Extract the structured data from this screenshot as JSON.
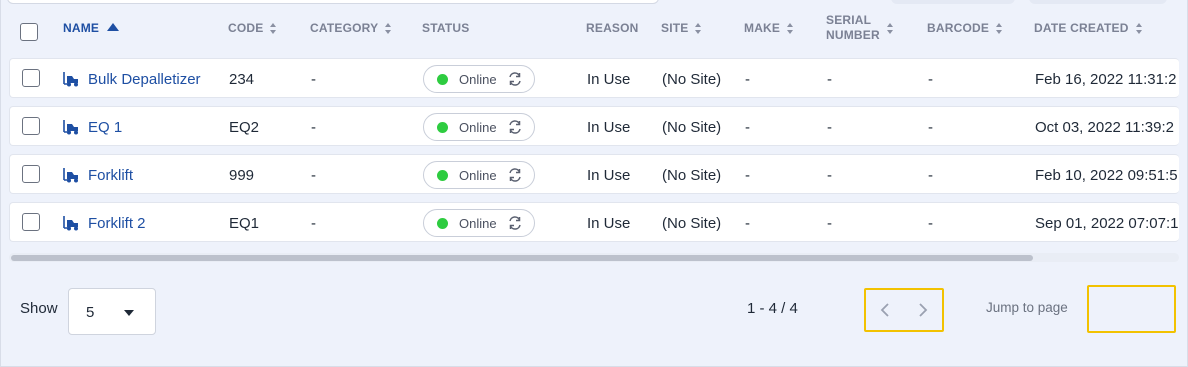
{
  "columns": {
    "name": "NAME",
    "code": "CODE",
    "category": "CATEGORY",
    "status": "STATUS",
    "reason": "REASON",
    "site": "SITE",
    "make": "MAKE",
    "serial_line1": "SERIAL",
    "serial_line2": "NUMBER",
    "barcode": "BARCODE",
    "date_created": "DATE CREATED"
  },
  "rows": [
    {
      "name": "Bulk Depalletizer",
      "code": "234",
      "category": "-",
      "status": "Online",
      "reason": "In Use",
      "site": "(No Site)",
      "make": "-",
      "serial": "-",
      "barcode": "-",
      "date_created": "Feb 16, 2022 11:31:2"
    },
    {
      "name": "EQ 1",
      "code": "EQ2",
      "category": "-",
      "status": "Online",
      "reason": "In Use",
      "site": "(No Site)",
      "make": "-",
      "serial": "-",
      "barcode": "-",
      "date_created": "Oct 03, 2022 11:39:2"
    },
    {
      "name": "Forklift",
      "code": "999",
      "category": "-",
      "status": "Online",
      "reason": "In Use",
      "site": "(No Site)",
      "make": "-",
      "serial": "-",
      "barcode": "-",
      "date_created": "Feb 10, 2022 09:51:5"
    },
    {
      "name": "Forklift 2",
      "code": "EQ1",
      "category": "-",
      "status": "Online",
      "reason": "In Use",
      "site": "(No Site)",
      "make": "-",
      "serial": "-",
      "barcode": "-",
      "date_created": "Sep 01, 2022 07:07:1"
    }
  ],
  "footer": {
    "show_label": "Show",
    "page_size": "5",
    "range": "1 - 4 / 4",
    "jump_label": "Jump to page",
    "jump_value": ""
  },
  "icons": {
    "equipment": "forklift-icon",
    "sync": "sync-icon",
    "prev": "chevron-left-icon",
    "next": "chevron-right-icon"
  },
  "colors": {
    "accent": "#1e4fa3",
    "status_online": "#2ecc40",
    "highlight": "#f2c200",
    "background": "#eef2fb"
  }
}
